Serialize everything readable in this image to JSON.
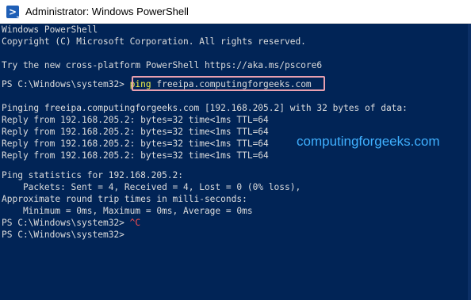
{
  "window": {
    "title": "Administrator: Windows PowerShell",
    "icon": "powershell-icon",
    "colors": {
      "console_bg": "#012456",
      "text": "#dddddd",
      "command": "#f2f24a",
      "ctrl_c": "#ff4f4f",
      "highlight_border": "#e8a0b0",
      "watermark": "#3fb0ff"
    }
  },
  "console": {
    "header1": "Windows PowerShell",
    "header2": "Copyright (C) Microsoft Corporation. All rights reserved.",
    "header3": "Try the new cross-platform PowerShell https://aka.ms/pscore6",
    "prompt1": "PS C:\\Windows\\system32> ",
    "cmd_name": "ping",
    "cmd_arg": " freeipa.computingforgeeks.com",
    "pinging": "Pinging freeipa.computingforgeeks.com [192.168.205.2] with 32 bytes of data:",
    "replies": [
      "Reply from 192.168.205.2: bytes=32 time<1ms TTL=64",
      "Reply from 192.168.205.2: bytes=32 time<1ms TTL=64",
      "Reply from 192.168.205.2: bytes=32 time<1ms TTL=64",
      "Reply from 192.168.205.2: bytes=32 time<1ms TTL=64"
    ],
    "stats_header": "Ping statistics for 192.168.205.2:",
    "stats_packets": "    Packets: Sent = 4, Received = 4, Lost = 0 (0% loss),",
    "stats_rtt_header": "Approximate round trip times in milli-seconds:",
    "stats_rtt": "    Minimum = 0ms, Maximum = 0ms, Average = 0ms",
    "prompt2": "PS C:\\Windows\\system32> ",
    "ctrl_c": "^C",
    "prompt3": "PS C:\\Windows\\system32>"
  },
  "watermark": "computingforgeeks.com"
}
